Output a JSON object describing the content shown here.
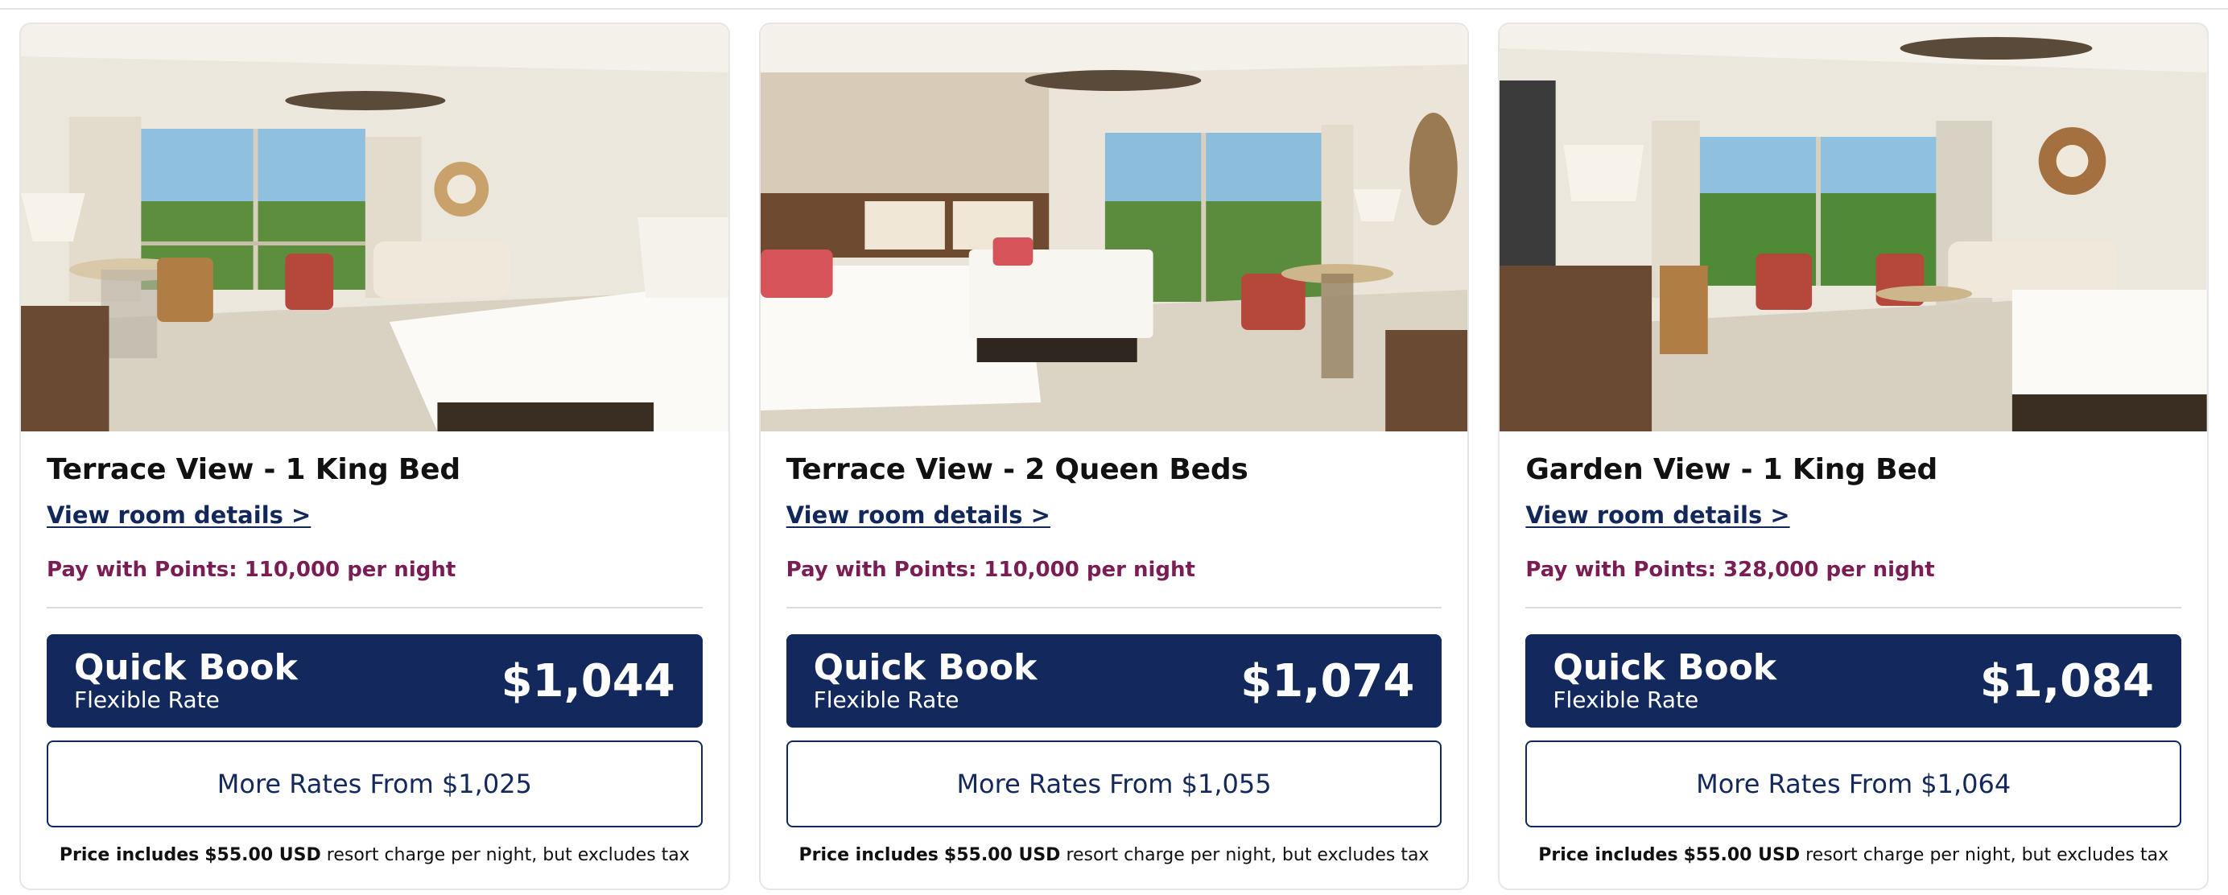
{
  "cards": [
    {
      "title": "Terrace View - 1 King Bed",
      "details_link": "View room details >",
      "points": "Pay with Points: 110,000 per night",
      "quick_book_label": "Quick Book",
      "quick_book_sub": "Flexible Rate",
      "quick_book_price": "$1,044",
      "more_rates": "More Rates From $1,025",
      "note_prefix": "Price includes",
      "note_amount": "$55.00 USD",
      "note_suffix": "resort charge per night, but excludes tax",
      "photo": "room-photo-king-bed-terrace"
    },
    {
      "title": "Terrace View - 2 Queen Beds",
      "details_link": "View room details >",
      "points": "Pay with Points: 110,000 per night",
      "quick_book_label": "Quick Book",
      "quick_book_sub": "Flexible Rate",
      "quick_book_price": "$1,074",
      "more_rates": "More Rates From $1,055",
      "note_prefix": "Price includes",
      "note_amount": "$55.00 USD",
      "note_suffix": "resort charge per night, but excludes tax",
      "photo": "room-photo-two-queen-beds-terrace"
    },
    {
      "title": "Garden View - 1 King Bed",
      "details_link": "View room details >",
      "points": "Pay with Points: 328,000 per night",
      "quick_book_label": "Quick Book",
      "quick_book_sub": "Flexible Rate",
      "quick_book_price": "$1,084",
      "more_rates": "More Rates From $1,064",
      "note_prefix": "Price includes",
      "note_amount": "$55.00 USD",
      "note_suffix": "resort charge per night, but excludes tax",
      "photo": "room-photo-king-bed-garden"
    }
  ],
  "colors": {
    "primary_navy": "#13285c",
    "points_plum": "#7a1d55",
    "divider": "#dcdcdc"
  }
}
